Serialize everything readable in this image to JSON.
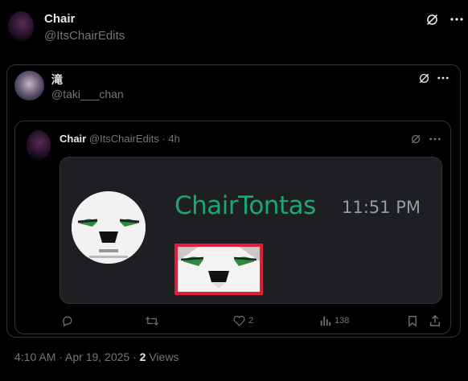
{
  "outer": {
    "name": "Chair",
    "handle": "@ItsChairEdits"
  },
  "quote": {
    "name": "滝",
    "handle": "@taki___chan"
  },
  "inner": {
    "name": "Chair",
    "handle": "@ItsChairEdits",
    "time": "4h",
    "media": {
      "username": "ChairTontas",
      "timestamp": "11:51 PM",
      "username_color": "#1aa870"
    }
  },
  "actions": {
    "likes": "2",
    "views": "138"
  },
  "footer": {
    "time_date": "4:10 AM · Apr 19, 2025 · ",
    "views_count": "2",
    "views_label": " Views"
  },
  "icons": [
    "grok-icon",
    "more-icon",
    "reply-icon",
    "retweet-icon",
    "like-icon",
    "views-icon",
    "bookmark-icon",
    "share-icon"
  ]
}
